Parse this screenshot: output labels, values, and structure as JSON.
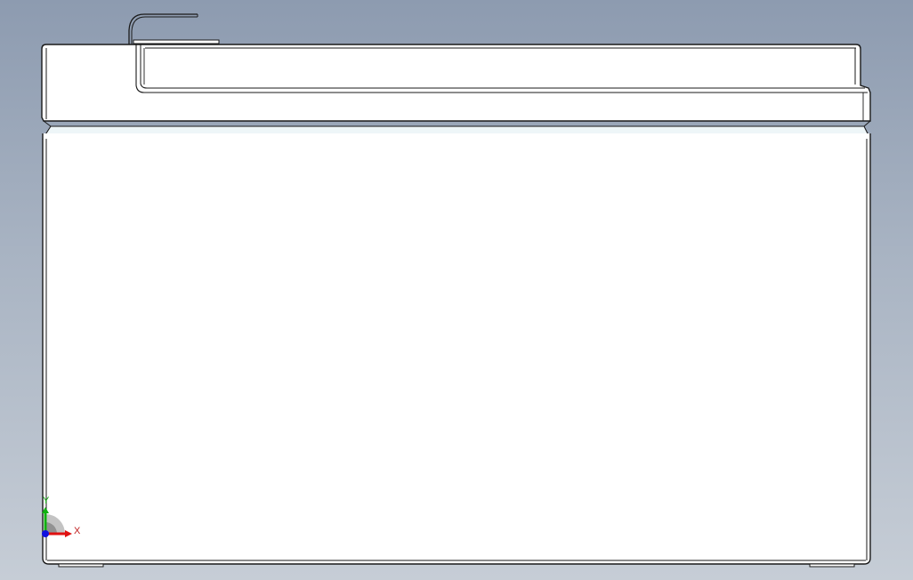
{
  "viewport": {
    "background_top": "#8d9bb0",
    "background_bottom": "#c6cdd6"
  },
  "model": {
    "body_fill": "#ffffff",
    "edge_color": "#1a1a1a",
    "highlight_band": "#eef6f8"
  },
  "triad": {
    "x_label": "X",
    "y_label": "Y",
    "x_color": "#e01010",
    "y_color": "#10b010",
    "z_color": "#1010e0",
    "label_color": "#c02020"
  }
}
